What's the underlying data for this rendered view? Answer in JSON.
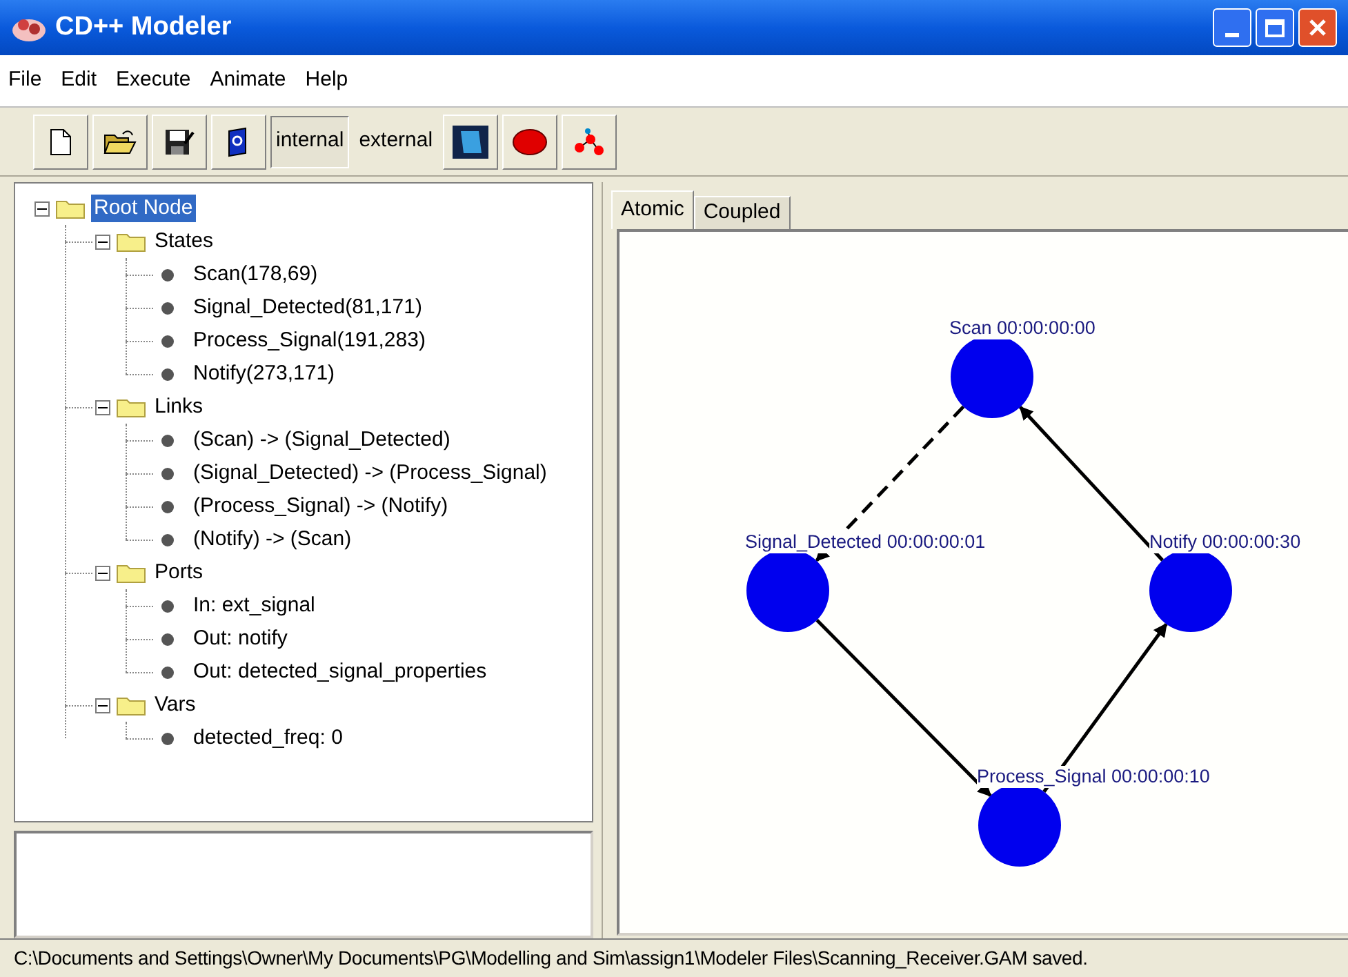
{
  "window": {
    "title": "CD++ Modeler"
  },
  "menu": [
    "File",
    "Edit",
    "Execute",
    "Animate",
    "Help"
  ],
  "toolbar": [
    {
      "kind": "new"
    },
    {
      "kind": "open"
    },
    {
      "kind": "save"
    },
    {
      "kind": "help"
    },
    {
      "kind": "toggle",
      "label": "internal",
      "selected": true
    },
    {
      "kind": "toggle",
      "label": "external",
      "selected": false
    },
    {
      "kind": "square"
    },
    {
      "kind": "stop"
    },
    {
      "kind": "graph"
    }
  ],
  "tree": {
    "label": "Root Node",
    "selected": true,
    "expanded": true,
    "children": [
      {
        "label": "States",
        "selected": false,
        "expanded": true,
        "children": [
          {
            "label": "Scan(178,69)",
            "selected": false
          },
          {
            "label": "Signal_Detected(81,171)",
            "selected": false
          },
          {
            "label": "Process_Signal(191,283)",
            "selected": false
          },
          {
            "label": "Notify(273,171)",
            "selected": false
          }
        ]
      },
      {
        "label": "Links",
        "selected": false,
        "expanded": true,
        "children": [
          {
            "label": "(Scan) -> (Signal_Detected)",
            "selected": false
          },
          {
            "label": "(Signal_Detected) -> (Process_Signal)",
            "selected": false
          },
          {
            "label": "(Process_Signal) -> (Notify)",
            "selected": false
          },
          {
            "label": "(Notify) -> (Scan)",
            "selected": false
          }
        ]
      },
      {
        "label": "Ports",
        "selected": false,
        "expanded": true,
        "children": [
          {
            "label": "In: ext_signal",
            "selected": false
          },
          {
            "label": "Out: notify",
            "selected": false
          },
          {
            "label": "Out: detected_signal_properties",
            "selected": false
          }
        ]
      },
      {
        "label": "Vars",
        "selected": false,
        "expanded": true,
        "children": [
          {
            "label": "detected_freq: 0",
            "selected": false
          }
        ]
      }
    ]
  },
  "tabs": [
    {
      "label": "Atomic",
      "selected": true
    },
    {
      "label": "Coupled",
      "selected": false
    }
  ],
  "graph": {
    "nodes": [
      {
        "label": "Scan 00:00:00:00"
      },
      {
        "label": "Signal_Detected 00:00:00:01"
      },
      {
        "label": "Process_Signal 00:00:00:10"
      },
      {
        "label": "Notify 00:00:00:30"
      }
    ],
    "edges": [
      {
        "dashed": true
      },
      {
        "dashed": false
      },
      {
        "dashed": false
      },
      {
        "dashed": false
      }
    ]
  },
  "status_bar": "C:\\Documents and Settings\\Owner\\My Documents\\PG\\Modelling and Sim\\assign1\\Modeler Files\\Scanning_Receiver.GAM saved."
}
